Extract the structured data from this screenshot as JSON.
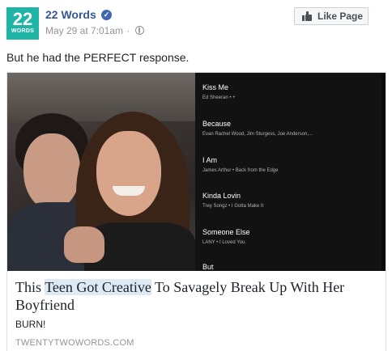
{
  "page": {
    "avatar_num": "22",
    "avatar_word": "WORDS",
    "name": "22 Words",
    "verified_glyph": "✓",
    "date": "May 29 at 7:01am",
    "separator": "·",
    "privacy_icon": "globe-icon"
  },
  "like_button": {
    "label": "Like Page",
    "icon": "thumbs-up-icon"
  },
  "status": "But he had the PERFECT response.",
  "playlist": [
    {
      "title": "Kiss Me",
      "artist": "Ed Sheeran • +"
    },
    {
      "title": "Because",
      "artist": "Evan Rachel Wood, Jim Sturgess, Joe Anderson,..."
    },
    {
      "title": "I Am",
      "artist": "James Arthur • Back from the Edge"
    },
    {
      "title": "Kinda Lovin",
      "artist": "Trey Songz • I Gotta Make It"
    },
    {
      "title": "Someone Else",
      "artist": "LANY • I Loved You."
    },
    {
      "title": "But",
      "artist": ""
    }
  ],
  "link": {
    "title_pre": "This ",
    "title_hl": "Teen Got Creative",
    "title_post": " To Savagely Break Up With Her Boyfriend",
    "subtitle": "BURN!",
    "domain": "TWENTYTWOWORDS.COM"
  },
  "colors": {
    "accent": "#365899",
    "avatar_bg": "#1fb5a6",
    "muted": "#90949c"
  }
}
